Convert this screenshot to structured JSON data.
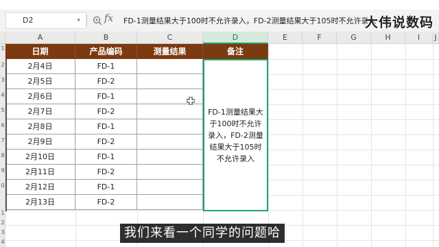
{
  "formula_bar": {
    "cell_ref": "D2",
    "fx_label": "fx",
    "formula_text": "FD-1测量结果大于100时不允许录入，FD-2测量结果大于105时不允许录入"
  },
  "watermark": "大伟说数码",
  "columns": [
    "A",
    "B",
    "C",
    "D",
    "E",
    "F",
    "G",
    "H",
    "I",
    "J"
  ],
  "row_numbers": [
    "1",
    "2",
    "3",
    "4",
    "5",
    "6",
    "7",
    "8",
    "9",
    "0",
    "1",
    "2",
    "3",
    "4"
  ],
  "table": {
    "headers": [
      "日期",
      "产品编码",
      "测量结果",
      "备注"
    ],
    "rows": [
      {
        "date": "2月4日",
        "code": "FD-1",
        "result": ""
      },
      {
        "date": "2月5日",
        "code": "FD-2",
        "result": ""
      },
      {
        "date": "2月6日",
        "code": "FD-1",
        "result": ""
      },
      {
        "date": "2月7日",
        "code": "FD-2",
        "result": ""
      },
      {
        "date": "2月8日",
        "code": "FD-1",
        "result": ""
      },
      {
        "date": "2月9日",
        "code": "FD-2",
        "result": ""
      },
      {
        "date": "2月10日",
        "code": "FD-1",
        "result": ""
      },
      {
        "date": "2月11日",
        "code": "FD-2",
        "result": ""
      },
      {
        "date": "2月12日",
        "code": "FD-1",
        "result": ""
      },
      {
        "date": "2月13日",
        "code": "FD-2",
        "result": ""
      }
    ],
    "note": "FD-1测量结果大于100时不允许录入，FD-2测量结果大于105时不允许录入"
  },
  "subtitle": "我们来看一个同学的问题哈",
  "colors": {
    "header_bg": "#7b3a10",
    "selection": "#21a366"
  }
}
